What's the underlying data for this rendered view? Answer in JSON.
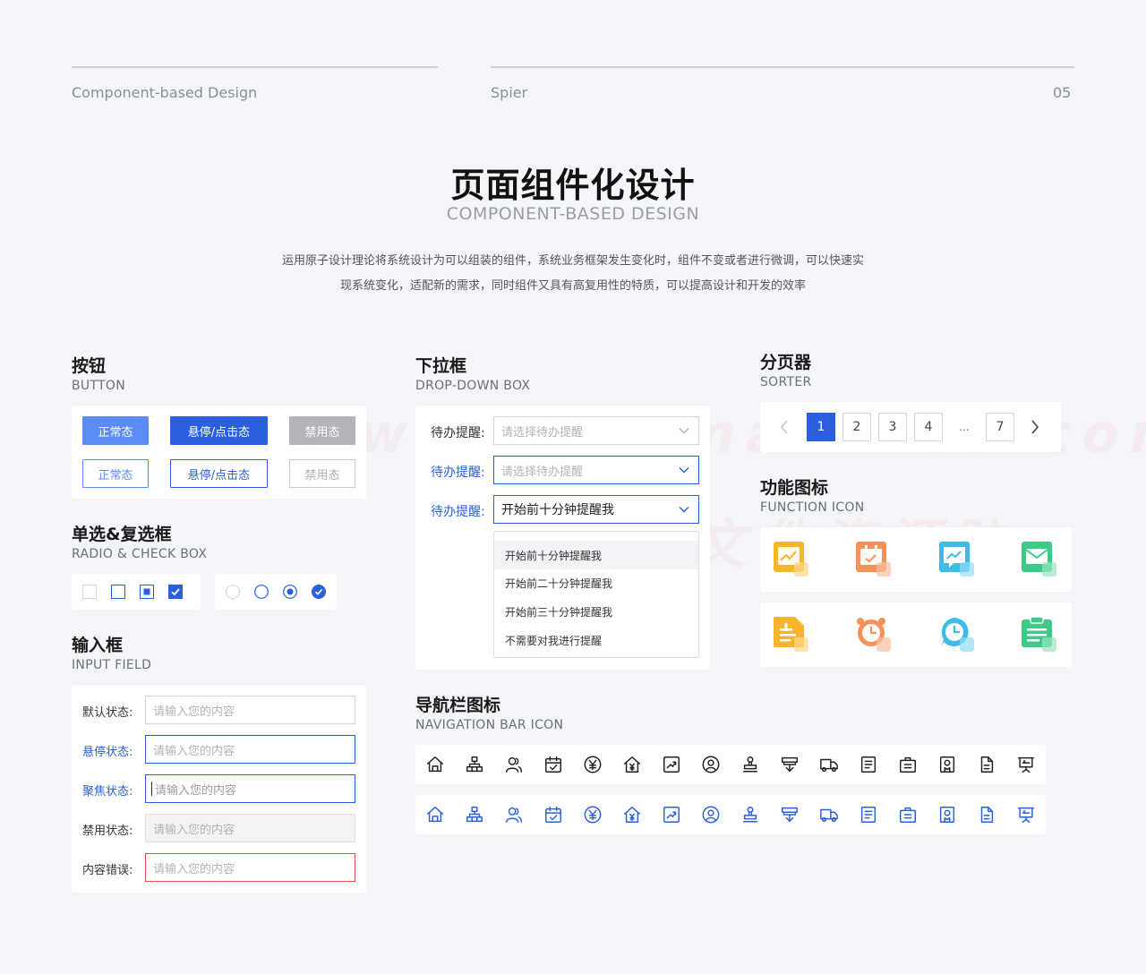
{
  "header": {
    "left_label": "Component-based Design",
    "mid_label": "Spier",
    "page_number": "05"
  },
  "hero": {
    "title": "页面组件化设计",
    "subtitle": "COMPONENT-BASED DESIGN",
    "desc_line1": "运用原子设计理论将系统设计为可以组装的组件，系统业务框架发生变化时，组件不变或者进行微调，可以快速实",
    "desc_line2": "现系统变化，适配新的需求，同时组件又具有高复用性的特质，可以提高设计和开发的效率"
  },
  "button_section": {
    "title": "按钮",
    "subtitle": "BUTTON",
    "normal": "正常态",
    "hover": "悬停/点击态",
    "disabled": "禁用态"
  },
  "radio_section": {
    "title": "单选&复选框",
    "subtitle": "RADIO & CHECK BOX"
  },
  "input_section": {
    "title": "输入框",
    "subtitle": "INPUT FIELD",
    "placeholder": "请输入您的内容",
    "rows": [
      {
        "label": "默认状态:"
      },
      {
        "label": "悬停状态:"
      },
      {
        "label": "聚焦状态:"
      },
      {
        "label": "禁用状态:"
      },
      {
        "label": "内容错误:"
      }
    ]
  },
  "dropdown_section": {
    "title": "下拉框",
    "subtitle": "DROP-DOWN BOX",
    "label": "待办提醒:",
    "placeholder": "请选择待办提醒",
    "selected": "开始前十分钟提醒我",
    "options": [
      "开始前十分钟提醒我",
      "开始前二十分钟提醒我",
      "开始前三十分钟提醒我",
      "不需要对我进行提醒"
    ]
  },
  "sorter_section": {
    "title": "分页器",
    "subtitle": "SORTER",
    "pages": [
      "1",
      "2",
      "3",
      "4",
      "...",
      "7"
    ],
    "current": "1"
  },
  "function_icon_section": {
    "title": "功能图标",
    "subtitle": "FUNCTION ICON",
    "icons": [
      "chart-doc-icon",
      "calendar-check-icon",
      "chat-chart-icon",
      "mail-icon",
      "note-add-icon",
      "alarm-clock-icon",
      "clock-bubble-icon",
      "clipboard-icon"
    ],
    "colors": {
      "yellow": "#f7b52c",
      "orange": "#f5925a",
      "cyan": "#3fbbe8",
      "green": "#3ecb8a"
    }
  },
  "nav_icon_section": {
    "title": "导航栏图标",
    "subtitle": "NAVIGATION BAR ICON",
    "icons": [
      "home-icon",
      "org-chart-icon",
      "users-icon",
      "calendar-icon",
      "yen-icon",
      "building-icon",
      "trend-icon",
      "user-circle-icon",
      "stamp-icon",
      "shop-icon",
      "truck-icon",
      "doc-list-icon",
      "briefcase-icon",
      "badge-icon",
      "file-icon",
      "presentation-icon"
    ],
    "color_dark": "#222222",
    "color_blue": "#2a5fe0"
  },
  "watermark": {
    "line1": "www.figma-files.com",
    "line2": "figma文件资源防"
  }
}
